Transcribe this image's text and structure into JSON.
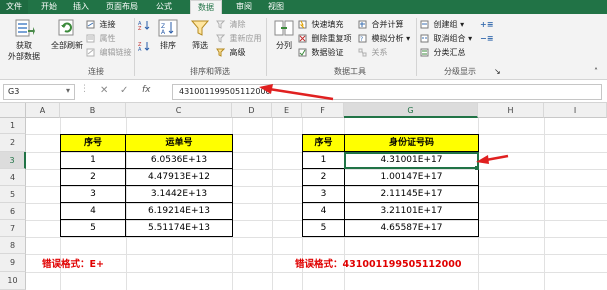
{
  "ribbon": {
    "tabs": [
      "文件",
      "开始",
      "插入",
      "页面布局",
      "公式",
      "数据",
      "审阅",
      "视图"
    ],
    "active_tab": "数据",
    "get_external": {
      "line1": "获取",
      "line2": "外部数据"
    },
    "refresh_all": "全部刷新",
    "connections": "连接",
    "properties": "属性",
    "edit_links": "编辑链接",
    "sort": "排序",
    "filter": "筛选",
    "clear": "清除",
    "reapply": "重新应用",
    "advanced": "高级",
    "text_to_columns": "分列",
    "flash_fill": "快速填充",
    "remove_duplicates": "删除重复项",
    "data_validation": "数据验证",
    "consolidate": "合并计算",
    "what_if": "模拟分析",
    "relationships": "关系",
    "group": "创建组",
    "ungroup": "取消组合",
    "subtotal": "分类汇总",
    "group_labels": {
      "connections": "连接",
      "sort_filter": "排序和筛选",
      "data_tools": "数据工具",
      "outline": "分级显示"
    }
  },
  "formula_bar": {
    "name_box": "G3",
    "fx": "fx",
    "formula": "431001199505112000"
  },
  "columns": [
    "A",
    "B",
    "C",
    "D",
    "E",
    "F",
    "G",
    "H",
    "I"
  ],
  "rows": [
    "1",
    "2",
    "3",
    "4",
    "5",
    "6",
    "7",
    "8",
    "9",
    "10"
  ],
  "table1": {
    "headers": [
      "序号",
      "运单号"
    ],
    "rows": [
      [
        "1",
        "6.0536E+13"
      ],
      [
        "2",
        "4.47913E+12"
      ],
      [
        "3",
        "3.1442E+13"
      ],
      [
        "4",
        "6.19214E+13"
      ],
      [
        "5",
        "5.51174E+13"
      ]
    ]
  },
  "table2": {
    "headers": [
      "序号",
      "身份证号码"
    ],
    "rows": [
      [
        "1",
        "4.31001E+17"
      ],
      [
        "2",
        "1.00147E+17"
      ],
      [
        "3",
        "2.11145E+17"
      ],
      [
        "4",
        "3.21101E+17"
      ],
      [
        "5",
        "4.65587E+17"
      ]
    ]
  },
  "annotations": {
    "error1": "错误格式：E+",
    "error2": "错误格式：431001199505112000"
  },
  "colors": {
    "excel_green": "#217346",
    "header_fill": "#ffff00",
    "error_red": "#e00000",
    "arrow_red": "#e02020"
  }
}
